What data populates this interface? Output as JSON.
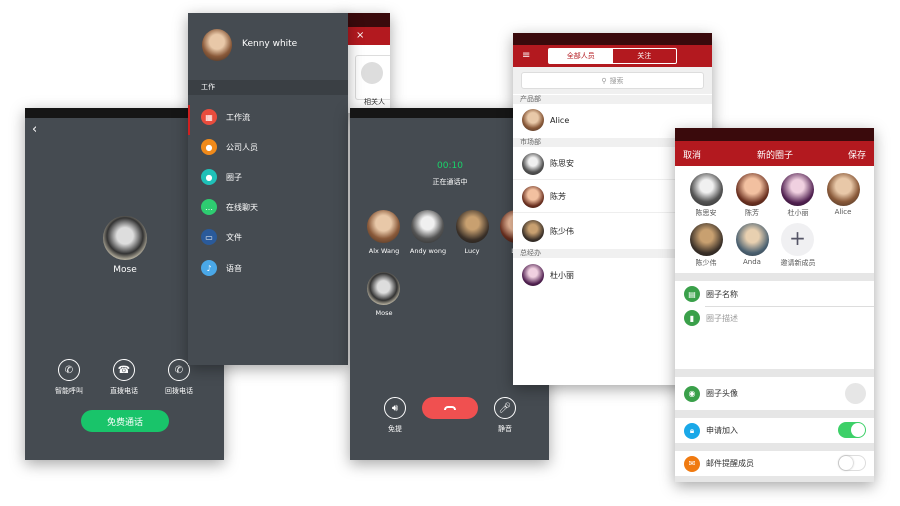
{
  "call_screen": {
    "back_icon": "chevron-left-icon",
    "contact_name": "Mose",
    "options": [
      {
        "label": "智能呼叫",
        "icon": "phone-icon"
      },
      {
        "label": "直拨电话",
        "icon": "telephone-icon"
      },
      {
        "label": "回拨电话",
        "icon": "phone-callback-icon"
      }
    ],
    "free_call_label": "免费通话"
  },
  "drawer": {
    "user_name": "Kenny white",
    "section_label": "工作",
    "items": [
      {
        "label": "工作流",
        "icon": "grid-icon",
        "color": "#e84c3d"
      },
      {
        "label": "公司人员",
        "icon": "person-icon",
        "color": "#f08a1a"
      },
      {
        "label": "圈子",
        "icon": "group-icon",
        "color": "#1fc0b8"
      },
      {
        "label": "在线聊天",
        "icon": "chat-icon",
        "color": "#2ecc71"
      },
      {
        "label": "文件",
        "icon": "inbox-icon",
        "color": "#2a5a9a"
      },
      {
        "label": "语音",
        "icon": "mic-icon",
        "color": "#4aa8e8"
      }
    ],
    "behind": {
      "close_icon": "×",
      "related_label": "相关人"
    }
  },
  "group_call": {
    "timer": "00:10",
    "status": "正在通话中",
    "participants": [
      "Alx Wang",
      "Andy wong",
      "Lucy",
      "L",
      "Mose"
    ],
    "speaker_label": "免提",
    "mute_label": "静音",
    "hangup_icon": "hangup-icon"
  },
  "contacts": {
    "tabs": [
      "全部人员",
      "关注"
    ],
    "active_tab": 0,
    "search_placeholder": "搜索",
    "sections": [
      {
        "name": "产品部",
        "people": [
          "Alice"
        ]
      },
      {
        "name": "市场部",
        "people": [
          "陈思安",
          "陈芳",
          "陈少伟"
        ]
      },
      {
        "name": "总经办",
        "people": [
          "杜小丽"
        ]
      }
    ]
  },
  "new_circle": {
    "cancel": "取消",
    "title": "新的圈子",
    "save": "保存",
    "members": [
      "陈思安",
      "陈芳",
      "杜小丽",
      "Alice",
      "陈少伟",
      "Anda"
    ],
    "invite_label": "邀请新成员",
    "name_placeholder": "圈子名称",
    "desc_placeholder": "圈子描述",
    "avatar_label": "圈子头像",
    "join_label": "申请加入",
    "join_enabled": true,
    "email_label": "邮件提醒成员",
    "email_enabled": false
  },
  "colors": {
    "brand_red": "#b3191f",
    "green": "#19c46a",
    "dark_bg": "#454b51",
    "hangup": "#f05050",
    "toggle_on": "#3dd068"
  }
}
